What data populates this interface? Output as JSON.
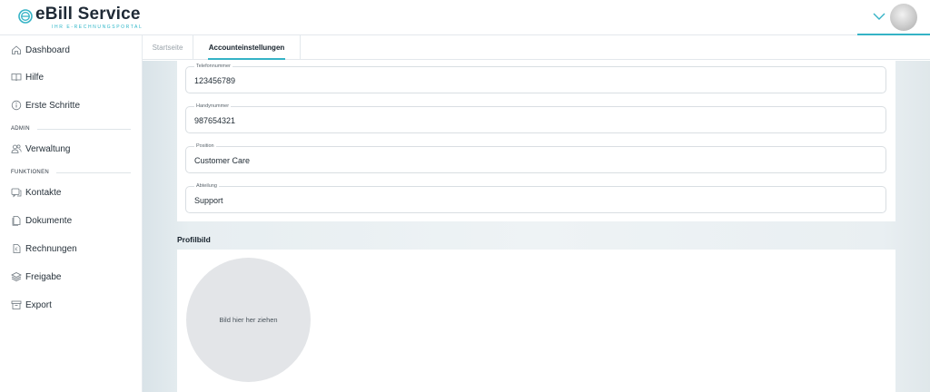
{
  "brand": {
    "title": "eBill Service",
    "subtitle": "IHR E-RECHNUNGSPORTAL",
    "accent_color": "#35b3c6"
  },
  "header": {
    "chevron_icon": "chevron-down-icon",
    "avatar_icon": "user-avatar"
  },
  "sidebar": {
    "items": [
      {
        "label": "Dashboard",
        "icon": "home-icon"
      },
      {
        "label": "Hilfe",
        "icon": "book-icon"
      },
      {
        "label": "Erste Schritte",
        "icon": "info-icon"
      },
      {
        "label": "Verwaltung",
        "icon": "users-icon"
      },
      {
        "label": "Kontakte",
        "icon": "contacts-icon"
      },
      {
        "label": "Dokumente",
        "icon": "documents-icon"
      },
      {
        "label": "Rechnungen",
        "icon": "invoice-icon"
      },
      {
        "label": "Freigabe",
        "icon": "layers-icon"
      },
      {
        "label": "Export",
        "icon": "archive-icon"
      }
    ],
    "sections": {
      "admin": "ADMIN",
      "funktionen": "FUNKTIONEN"
    }
  },
  "tabs": {
    "start": "Startseite",
    "account": "Accounteinstellungen"
  },
  "form": {
    "phone": {
      "label": "Telefonnummer",
      "value": "123456789"
    },
    "mobile": {
      "label": "Handynummer",
      "value": "987654321"
    },
    "position": {
      "label": "Position",
      "value": "Customer Care"
    },
    "department": {
      "label": "Abteilung",
      "value": "Support"
    }
  },
  "profile": {
    "title": "Profilbild",
    "dropzone_text": "Bild hier her ziehen"
  }
}
